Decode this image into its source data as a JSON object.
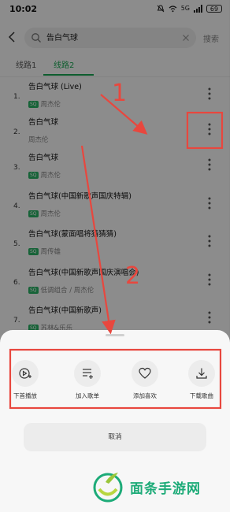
{
  "status_bar": {
    "time": "10:02",
    "icons": [
      "mute-icon",
      "wifi-icon",
      "signal-icon"
    ],
    "signal_text": "5G",
    "battery": "69"
  },
  "header": {
    "search_value": "告白气球",
    "search_button": "搜索"
  },
  "tabs": [
    {
      "label": "线路1",
      "active": false
    },
    {
      "label": "线路2",
      "active": true
    }
  ],
  "songs": [
    {
      "num": "1.",
      "title": "告白气球 (Live)",
      "badge": "SQ",
      "artist": "周杰伦"
    },
    {
      "num": "2.",
      "title": "告白气球",
      "badge": "",
      "artist": "周杰伦"
    },
    {
      "num": "3.",
      "title": "告白气球",
      "badge": "SQ",
      "artist": "周杰伦"
    },
    {
      "num": "4.",
      "title": "告白气球(中国新歌声国庆特辑)",
      "badge": "SQ",
      "artist": "周杰伦"
    },
    {
      "num": "5.",
      "title": "告白气球(蒙面唱将猜猜猜)",
      "badge": "SQ",
      "artist": "周传雄"
    },
    {
      "num": "6.",
      "title": "告白气球(中国新歌声国庆演唱会)",
      "badge": "SQ",
      "artist": "低调组合 / 周杰伦"
    },
    {
      "num": "7.",
      "title": "告白气球(中国新歌声)",
      "badge": "SQ",
      "artist": "苏林&乐乐"
    }
  ],
  "sheet": {
    "actions": [
      {
        "label": "下首播放",
        "icon": "play-next-icon"
      },
      {
        "label": "加入歌单",
        "icon": "add-to-playlist-icon"
      },
      {
        "label": "添加喜欢",
        "icon": "heart-icon"
      },
      {
        "label": "下载歌曲",
        "icon": "download-icon"
      }
    ],
    "cancel": "取消"
  },
  "annotations": {
    "step1": "1",
    "step2": "2",
    "color": "#e8473e"
  },
  "watermark": {
    "text": "面条手游网"
  },
  "colors": {
    "accent": "#1aaa55",
    "annotation_red": "#e8473e",
    "watermark_green": "#1dab78"
  }
}
